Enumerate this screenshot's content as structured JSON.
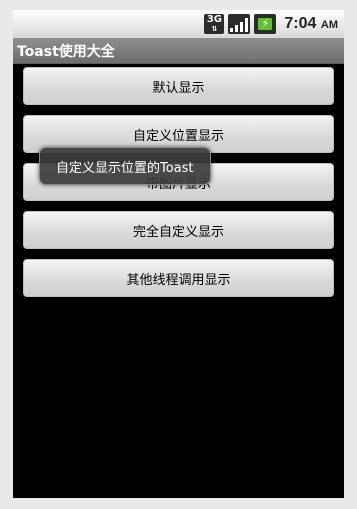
{
  "status_bar": {
    "network_label": "3G",
    "network_arrows": "⇅",
    "battery_bolt": "⚡",
    "time": "7:04",
    "ampm": "AM"
  },
  "app": {
    "title": "Toast使用大全"
  },
  "buttons": [
    {
      "label": "默认显示"
    },
    {
      "label": "自定义位置显示"
    },
    {
      "label": "带图片显示"
    },
    {
      "label": "完全自定义显示"
    },
    {
      "label": "其他线程调用显示"
    }
  ],
  "toast": {
    "text": "自定义显示位置的Toast"
  },
  "colors": {
    "screen_background": "#000000",
    "title_bar": "#7d7d7d",
    "battery_green": "#5ec22b"
  }
}
